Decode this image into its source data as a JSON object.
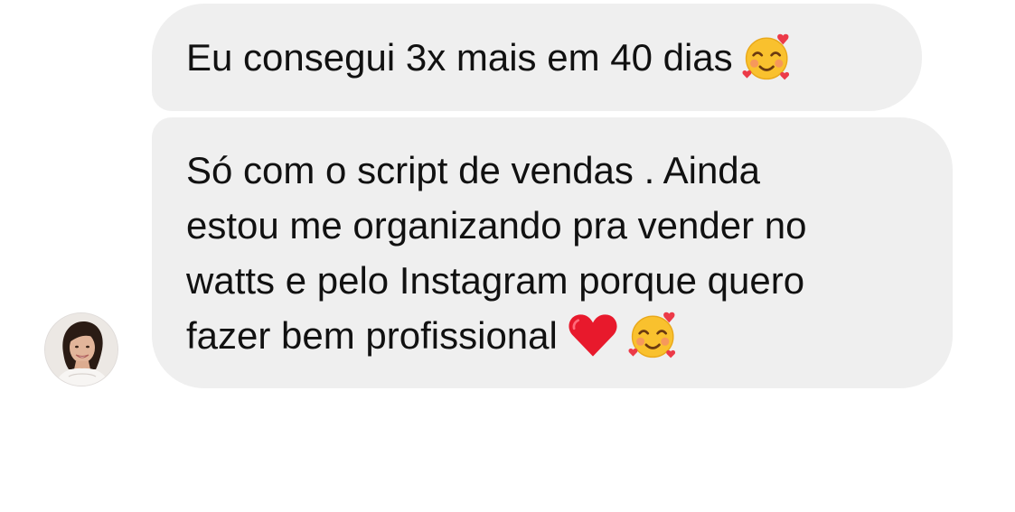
{
  "messages": [
    {
      "lines": [
        "Eu consegui 3x mais em 40 dias"
      ],
      "trailing_emojis": [
        "smiling-face-with-hearts-emoji"
      ]
    },
    {
      "lines": [
        "Só com o script de vendas . Ainda",
        "estou me organizando pra vender no",
        "watts e pelo Instagram porque quero",
        "fazer bem profissional"
      ],
      "trailing_emojis": [
        "red-heart-emoji",
        "smiling-face-with-hearts-emoji"
      ]
    }
  ],
  "sender": {
    "avatar_icon": "avatar-photo"
  },
  "colors": {
    "bubble_background": "#efefef",
    "text": "#111111",
    "page_background": "#ffffff"
  }
}
